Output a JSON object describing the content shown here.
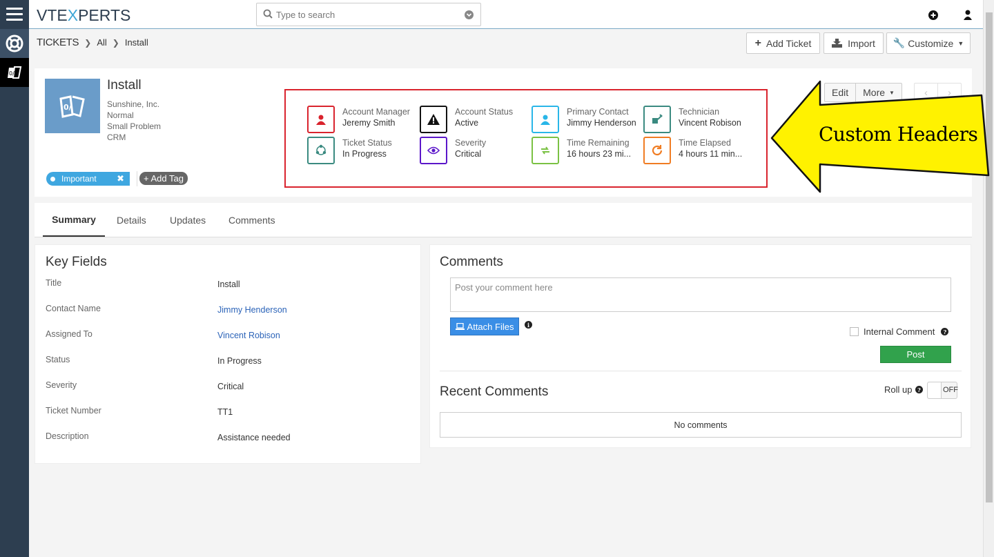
{
  "app": {
    "logo_prefix": "VTE",
    "logo_x": "X",
    "logo_suffix": "PERTS"
  },
  "search": {
    "placeholder": "Type to search"
  },
  "breadcrumb": {
    "module": "TICKETS",
    "filter": "All",
    "record": "Install"
  },
  "actions": {
    "add_ticket": "Add Ticket",
    "import": "Import",
    "customize": "Customize"
  },
  "record": {
    "title": "Install",
    "meta": [
      "Sunshine, Inc.",
      "Normal",
      "Small Problem",
      "CRM"
    ],
    "tag": "Important",
    "add_tag": "+ Add Tag",
    "edit": "Edit",
    "more": "More"
  },
  "header_fields": [
    {
      "label": "Account Manager",
      "value": "Jeremy Smith",
      "icon": "user-icon",
      "color": "#d9232d"
    },
    {
      "label": "Account Status",
      "value": "Active",
      "icon": "warning-icon",
      "color": "#111111"
    },
    {
      "label": "Primary Contact",
      "value": "Jimmy Henderson",
      "icon": "contact-icon",
      "color": "#29b6e8"
    },
    {
      "label": "Technician",
      "value": "Vincent Robison",
      "icon": "technician-icon",
      "color": "#3a8a80"
    },
    {
      "label": "Ticket Status",
      "value": "In Progress",
      "icon": "share-icon",
      "color": "#3a8a80"
    },
    {
      "label": "Severity",
      "value": "Critical",
      "icon": "eye-icon",
      "color": "#5b16c9"
    },
    {
      "label": "Time Remaining",
      "value": "16 hours 23 mi...",
      "icon": "refresh-arrows-icon",
      "color": "#7ac143"
    },
    {
      "label": "Time Elapsed",
      "value": "4 hours 11 min...",
      "icon": "reload-icon",
      "color": "#f07c22"
    }
  ],
  "annotation": {
    "text": "Custom Headers",
    "color": "#fff200"
  },
  "tabs": [
    "Summary",
    "Details",
    "Updates",
    "Comments"
  ],
  "key_fields": {
    "title": "Key Fields",
    "rows": [
      {
        "label": "Title",
        "value": "Install"
      },
      {
        "label": "Contact Name",
        "value": "Jimmy Henderson"
      },
      {
        "label": "Assigned To",
        "value": "Vincent Robison"
      },
      {
        "label": "Status",
        "value": "In Progress"
      },
      {
        "label": "Severity",
        "value": "Critical"
      },
      {
        "label": "Ticket Number",
        "value": "TT1"
      },
      {
        "label": "Description",
        "value": "Assistance needed"
      }
    ]
  },
  "comments": {
    "title": "Comments",
    "placeholder": "Post your comment here",
    "attach": "Attach Files",
    "internal": "Internal Comment",
    "post": "Post",
    "recent_title": "Recent Comments",
    "rollup": "Roll up",
    "toggle": "OFF",
    "empty": "No comments"
  }
}
